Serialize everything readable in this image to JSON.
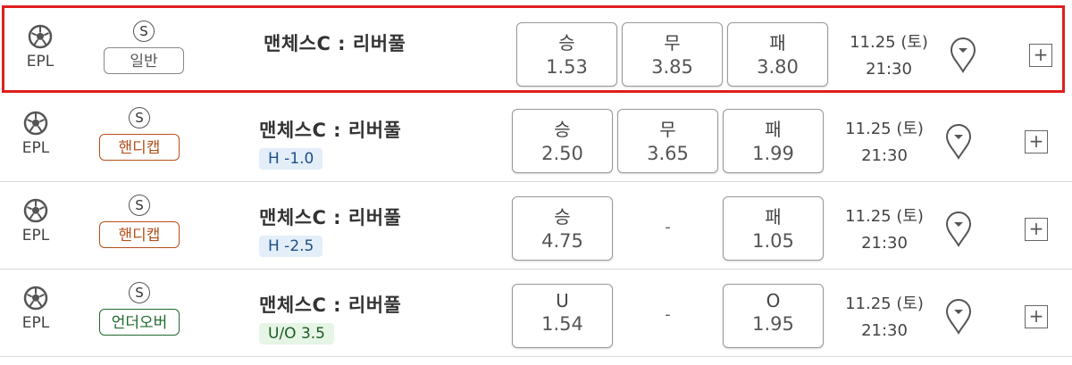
{
  "rows": [
    {
      "league": "EPL",
      "type_badge": "S",
      "type_label": "일반",
      "type_style": "normal",
      "match": "맨체스C : 리버풀",
      "line": "",
      "odds": [
        {
          "label": "승",
          "value": "1.53"
        },
        {
          "label": "무",
          "value": "3.85"
        },
        {
          "label": "패",
          "value": "3.80"
        }
      ],
      "date": "11.25 (토)",
      "time": "21:30",
      "selected": true
    },
    {
      "league": "EPL",
      "type_badge": "S",
      "type_label": "핸디캡",
      "type_style": "handicap",
      "match": "맨체스C : 리버풀",
      "line": "H -1.0",
      "line_style": "h",
      "odds": [
        {
          "label": "승",
          "value": "2.50"
        },
        {
          "label": "무",
          "value": "3.65"
        },
        {
          "label": "패",
          "value": "1.99"
        }
      ],
      "date": "11.25 (토)",
      "time": "21:30",
      "selected": false
    },
    {
      "league": "EPL",
      "type_badge": "S",
      "type_label": "핸디캡",
      "type_style": "handicap",
      "match": "맨체스C : 리버풀",
      "line": "H -2.5",
      "line_style": "h",
      "odds": [
        {
          "label": "승",
          "value": "4.75"
        },
        {
          "label": "패",
          "value": "1.05"
        }
      ],
      "middle": "-",
      "date": "11.25 (토)",
      "time": "21:30",
      "selected": false
    },
    {
      "league": "EPL",
      "type_badge": "S",
      "type_label": "언더오버",
      "type_style": "uo",
      "match": "맨체스C : 리버풀",
      "line": "U/O 3.5",
      "line_style": "uo",
      "odds": [
        {
          "label": "U",
          "value": "1.54"
        },
        {
          "label": "O",
          "value": "1.95"
        }
      ],
      "middle": "-",
      "date": "11.25 (토)",
      "time": "21:30",
      "selected": false
    }
  ],
  "icons": {
    "league": "soccer-ball-icon",
    "pin": "map-pin-chevron-icon",
    "expand": "plus-icon"
  },
  "plus_label": "+",
  "colors": {
    "selected_border": "#e01e1e",
    "handicap": "#b5501b",
    "under_over": "#1d6a2c",
    "line_h_bg": "#e3eef9",
    "line_uo_bg": "#e6f5e6"
  }
}
